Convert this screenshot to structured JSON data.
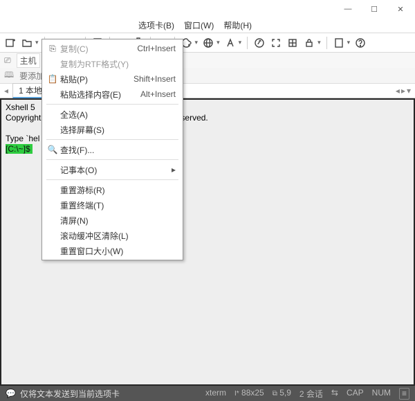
{
  "titlebuttons": {
    "min": "—",
    "max": "☐",
    "close": "✕"
  },
  "menubar": {
    "tabs": "选项卡(B)",
    "window": "窗口(W)",
    "help": "帮助(H)"
  },
  "hostrow": {
    "label": "主机"
  },
  "favrow": {
    "label": "要添加"
  },
  "tabrow": {
    "tab1": "1 本地S"
  },
  "terminal": {
    "line1": "Xshell 5 ",
    "line2": "Copyright                              ter, Inc. All rights reserved.",
    "line3": "",
    "line4": "Type `hel                              prompt.",
    "prompt": "[C:\\~]$ "
  },
  "context": {
    "copy": "复制(C)",
    "copy_sc": "Ctrl+Insert",
    "copyrtf": "复制为RTF格式(Y)",
    "paste": "粘贴(P)",
    "paste_sc": "Shift+Insert",
    "pastesel": "粘贴选择内容(E)",
    "pastesel_sc": "Alt+Insert",
    "selectall": "全选(A)",
    "selscreen": "选择屏幕(S)",
    "find": "查找(F)...",
    "notepad": "记事本(O)",
    "resetcursor": "重置游标(R)",
    "resetterm": "重置终端(T)",
    "clear": "清屏(N)",
    "clearbuf": "滚动缓冲区清除(L)",
    "resetwin": "重置窗口大小(W)"
  },
  "status": {
    "msg": "仅将文本发送到当前选项卡",
    "termtype": "xterm",
    "size": "88x25",
    "cursor": "5,9",
    "sessions": "2 会话",
    "cap": "CAP",
    "num": "NUM"
  }
}
